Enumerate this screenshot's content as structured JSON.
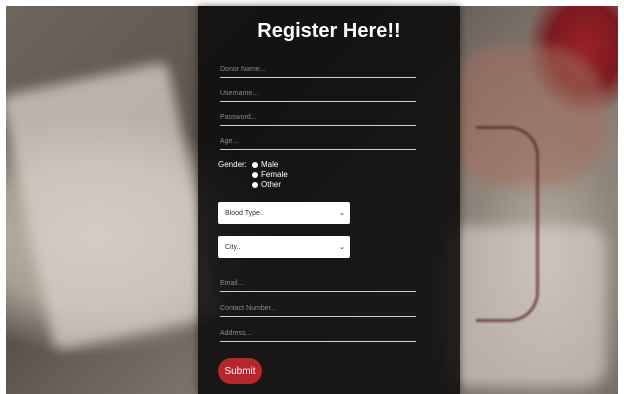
{
  "form": {
    "title": "Register Here!!",
    "donor_name_placeholder": "Donor Name...",
    "username_placeholder": "Username...",
    "password_placeholder": "Password...",
    "age_placeholder": "Age...",
    "gender_label": "Gender:",
    "gender_options": [
      "Male",
      "Female",
      "Other"
    ],
    "blood_type_selected": "Blood Type..",
    "city_selected": "City..",
    "email_placeholder": "Email...",
    "contact_placeholder": "Contact Number...",
    "address_placeholder": "Address...",
    "submit_label": "Submit"
  },
  "colors": {
    "panel_bg": "#0a0a0a",
    "accent_button": "#b5272d"
  }
}
